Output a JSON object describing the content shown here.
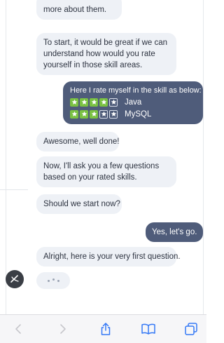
{
  "messages": [
    {
      "role": "bot",
      "lines": [
        "more about them."
      ]
    },
    {
      "role": "bot",
      "lines": [
        "To start, it would be great if we can",
        "understand how would you rate",
        "yourself in those skill areas."
      ]
    },
    {
      "role": "user",
      "intro": "Here I rate myself in the skill as below:",
      "ratings": [
        {
          "skill": "Java",
          "stars": 4,
          "max": 5
        },
        {
          "skill": "MySQL",
          "stars": 3,
          "max": 5
        }
      ]
    },
    {
      "role": "bot",
      "lines": [
        "Awesome, well done!"
      ]
    },
    {
      "role": "bot",
      "lines": [
        "Now, I'll ask you a few questions",
        "based on your rated skills."
      ]
    },
    {
      "role": "bot",
      "lines": [
        "Should we start now?"
      ]
    },
    {
      "role": "user",
      "lines": [
        "Yes, let's go."
      ]
    },
    {
      "role": "bot",
      "lines": [
        "Alright, here is your very first question."
      ]
    }
  ],
  "colors": {
    "bot_bubble": "#eef1f6",
    "user_bubble": "#4f5c7a",
    "star_filled": "#7ac142",
    "toolbar_icon": "#3478f6",
    "toolbar_icon_disabled": "#c7c7cc"
  },
  "toolbar": {
    "icons": [
      "back-icon",
      "forward-icon",
      "share-icon",
      "bookmarks-icon",
      "tabs-icon"
    ]
  }
}
